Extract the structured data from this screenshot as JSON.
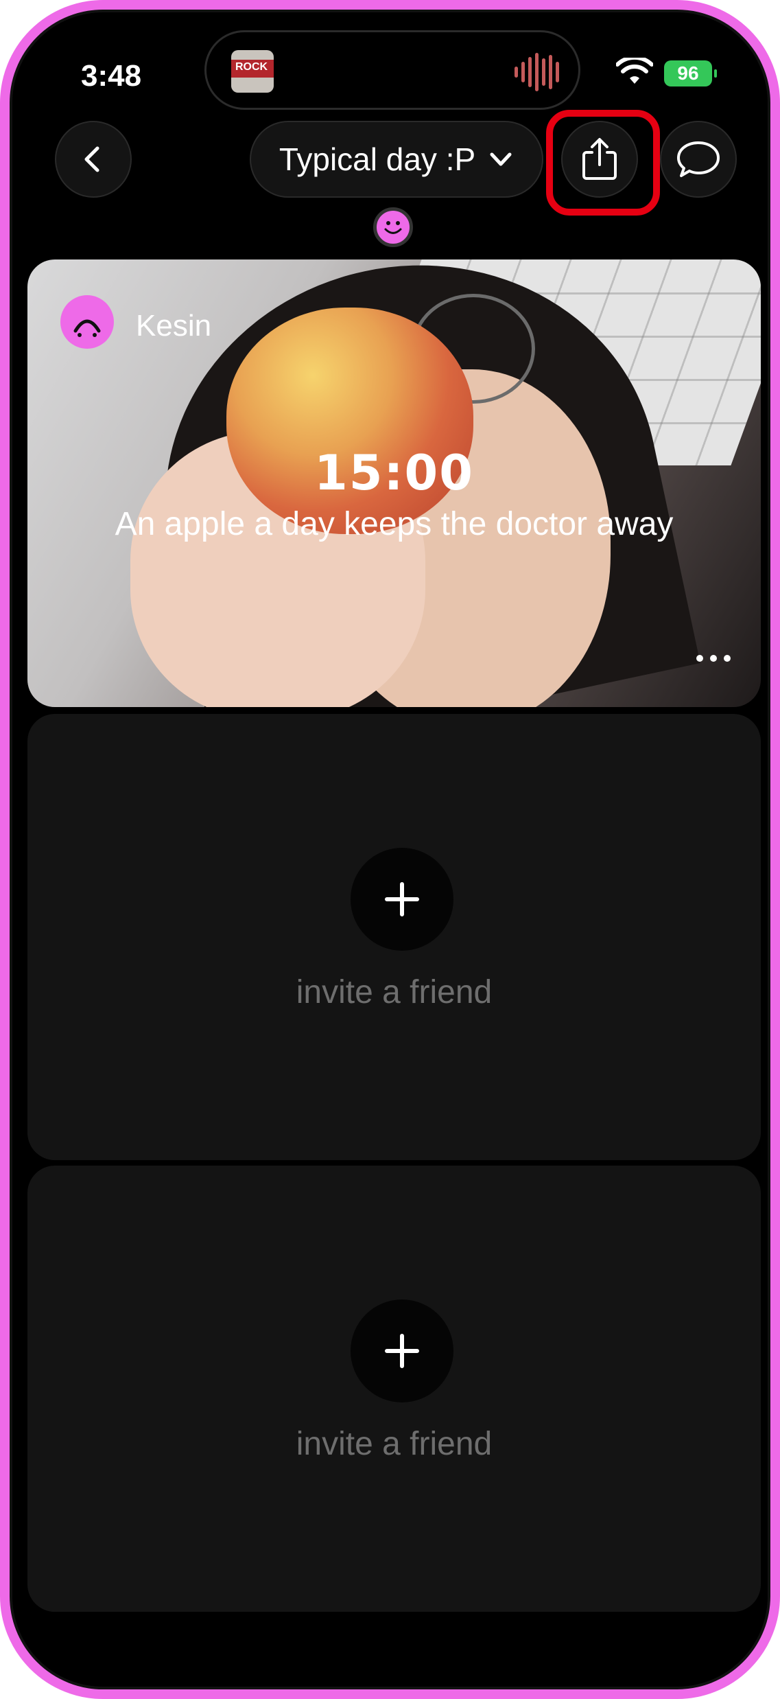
{
  "status_bar": {
    "time": "3:48",
    "battery_level": "96",
    "now_playing_art_text": "ROCK"
  },
  "header": {
    "title": "Typical day :P"
  },
  "post": {
    "username": "Kesin",
    "time": "15:00",
    "caption": "An apple a day keeps the doctor away"
  },
  "invite_slots": [
    {
      "label": "invite a friend"
    },
    {
      "label": "invite a friend"
    }
  ],
  "colors": {
    "accent_pink": "#ee6ae8",
    "highlight_red": "#e60012",
    "battery_green": "#34c759"
  }
}
